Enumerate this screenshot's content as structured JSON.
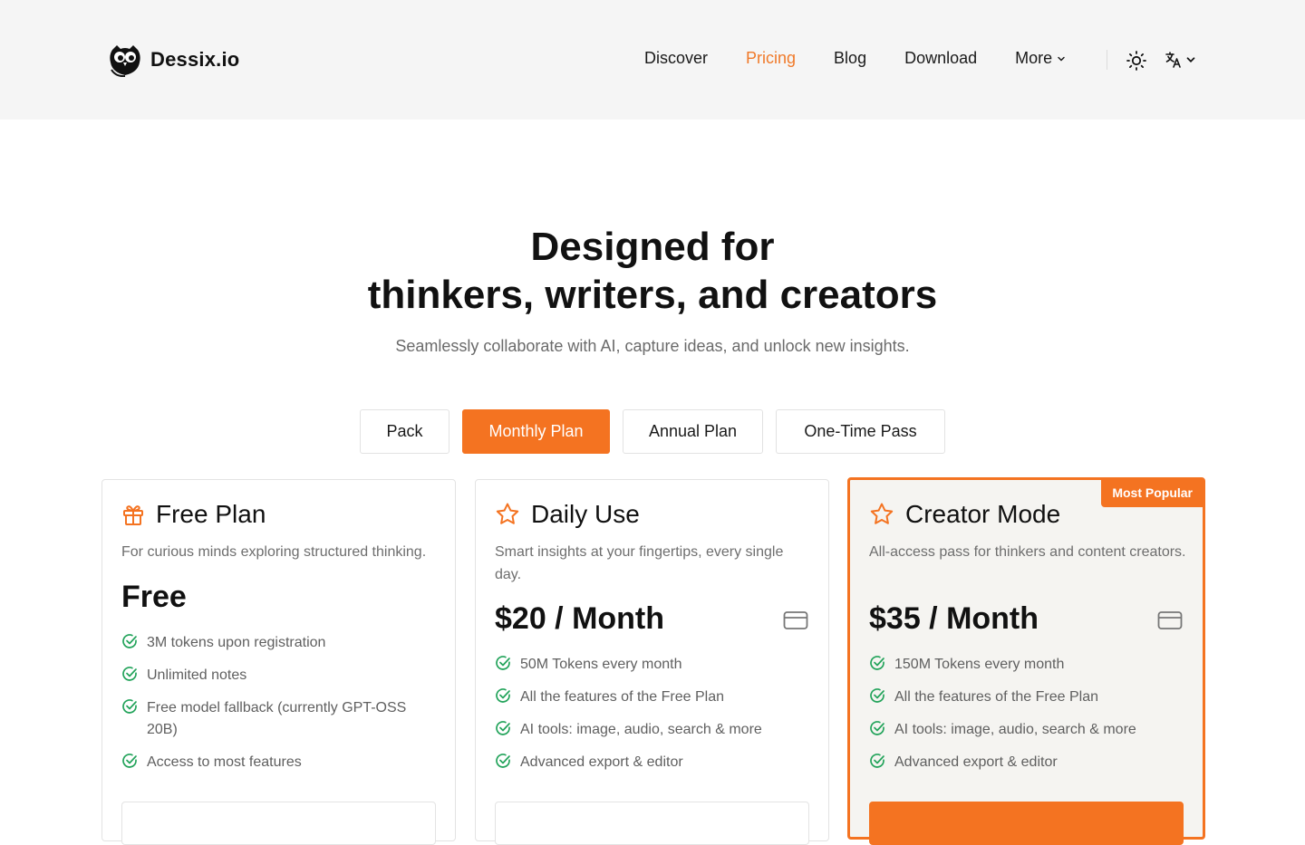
{
  "brand": {
    "name": "Dessix.io"
  },
  "nav": {
    "items": [
      {
        "label": "Discover",
        "active": false
      },
      {
        "label": "Pricing",
        "active": true
      },
      {
        "label": "Blog",
        "active": false
      },
      {
        "label": "Download",
        "active": false
      },
      {
        "label": "More",
        "active": false
      }
    ]
  },
  "hero": {
    "title_line1": "Designed for",
    "title_line2": "thinkers, writers, and creators",
    "subtitle": "Seamlessly collaborate with AI, capture ideas, and unlock new insights."
  },
  "tabs": [
    {
      "label": "Pack",
      "active": false
    },
    {
      "label": "Monthly Plan",
      "active": true
    },
    {
      "label": "Annual Plan",
      "active": false
    },
    {
      "label": "One-Time Pass",
      "active": false
    }
  ],
  "plans": [
    {
      "icon": "gift-icon",
      "title": "Free Plan",
      "description": "For curious minds exploring structured thinking.",
      "price": "Free",
      "features": [
        "3M tokens upon registration",
        "Unlimited notes",
        "Free model fallback (currently GPT-OSS 20B)",
        "Access to most features"
      ]
    },
    {
      "icon": "star-icon",
      "title": "Daily Use",
      "description": "Smart insights at your fingertips, every single day.",
      "price": "$20 / Month",
      "features": [
        "50M Tokens every month",
        "All the features of the Free Plan",
        "AI tools: image, audio, search & more",
        "Advanced export & editor"
      ]
    },
    {
      "icon": "star-icon",
      "title": "Creator Mode",
      "badge": "Most Popular",
      "description": "All-access pass for thinkers and content creators.",
      "price": "$35 / Month",
      "features": [
        "150M Tokens every month",
        "All the features of the Free Plan",
        "AI tools: image, audio, search & more",
        "Advanced export & editor"
      ]
    }
  ],
  "colors": {
    "accent": "#f47321",
    "header_bg": "#f5f5f5",
    "check": "#22a35a"
  }
}
